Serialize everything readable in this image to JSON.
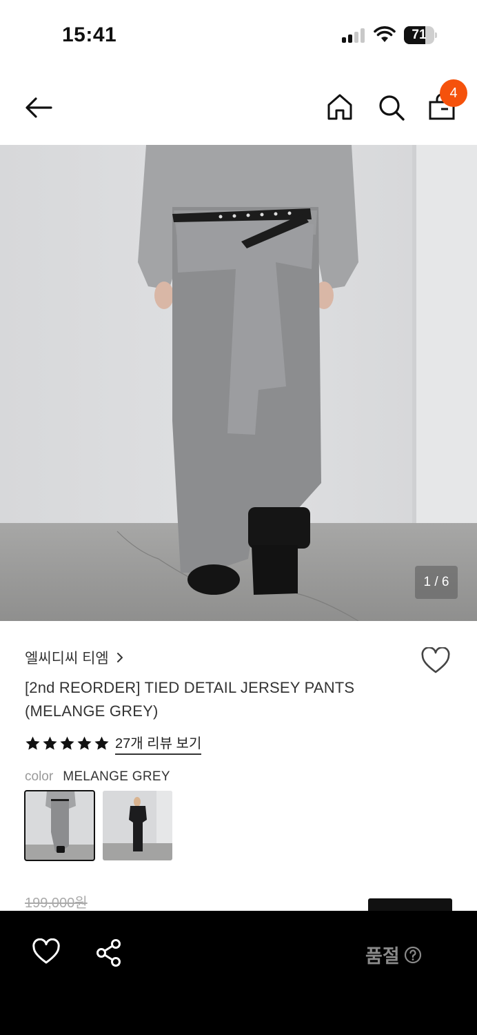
{
  "status_bar": {
    "time": "15:41",
    "battery_level": "71",
    "battery_fraction": 0.71,
    "signal_bars_active": 2,
    "signal_bars_total": 4,
    "icons": [
      "cellular-signal-icon",
      "wifi-icon",
      "battery-icon"
    ]
  },
  "header": {
    "icons": [
      "back-arrow-icon",
      "home-icon",
      "search-icon",
      "shopping-bag-icon"
    ],
    "cart_count": "4",
    "badge_color": "#f5520c"
  },
  "gallery": {
    "counter": "1 / 6",
    "current_index": 1,
    "total": 6
  },
  "product": {
    "brand": "엘씨디씨 티엠",
    "title": "[2nd REORDER] TIED DETAIL JERSEY PANTS (MELANGE GREY)",
    "rating_stars": 5,
    "review_link": "27개 리뷰 보기",
    "color_label": "color",
    "color_value": "MELANGE GREY",
    "swatch_count": 2,
    "selected_swatch": 1,
    "original_price": "199,000원"
  },
  "bottom_bar": {
    "icons": [
      "heart-icon",
      "share-icon",
      "help-circle-icon"
    ],
    "status_label": "품절"
  }
}
